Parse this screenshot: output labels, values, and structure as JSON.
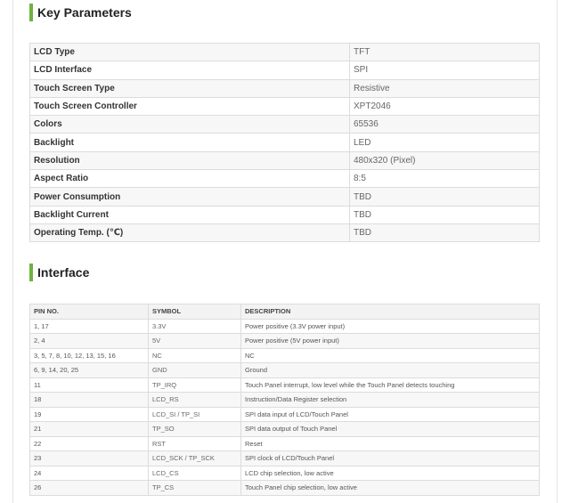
{
  "key_parameters": {
    "title": "Key Parameters",
    "rows": [
      {
        "key": "LCD Type",
        "value": "TFT"
      },
      {
        "key": "LCD Interface",
        "value": "SPI"
      },
      {
        "key": "Touch Screen Type",
        "value": "Resistive"
      },
      {
        "key": "Touch Screen Controller",
        "value": "XPT2046"
      },
      {
        "key": "Colors",
        "value": "65536"
      },
      {
        "key": "Backlight",
        "value": "LED"
      },
      {
        "key": "Resolution",
        "value": "480x320 (Pixel)"
      },
      {
        "key": "Aspect Ratio",
        "value": "8:5"
      },
      {
        "key": "Power Consumption",
        "value": "TBD"
      },
      {
        "key": "Backlight Current",
        "value": "TBD"
      },
      {
        "key": "Operating Temp. (℃)",
        "value": "TBD"
      }
    ]
  },
  "interface": {
    "title": "Interface",
    "headers": [
      "PIN NO.",
      "SYMBOL",
      "DESCRIPTION"
    ],
    "rows": [
      {
        "pin": "1, 17",
        "symbol": "3.3V",
        "desc": "Power positive (3.3V power input)"
      },
      {
        "pin": "2, 4",
        "symbol": "5V",
        "desc": "Power positive (5V power input)"
      },
      {
        "pin": "3, 5, 7, 8, 10, 12, 13, 15, 16",
        "symbol": "NC",
        "desc": "NC"
      },
      {
        "pin": "6, 9, 14, 20, 25",
        "symbol": "GND",
        "desc": "Ground"
      },
      {
        "pin": "11",
        "symbol": "TP_IRQ",
        "desc": "Touch Panel interrupt, low level while the Touch Panel detects touching"
      },
      {
        "pin": "18",
        "symbol": "LCD_RS",
        "desc": "Instruction/Data Register selection"
      },
      {
        "pin": "19",
        "symbol": "LCD_SI / TP_SI",
        "desc": "SPI data input of LCD/Touch Panel"
      },
      {
        "pin": "21",
        "symbol": "TP_SO",
        "desc": "SPI data output of Touch Panel"
      },
      {
        "pin": "22",
        "symbol": "RST",
        "desc": "Reset"
      },
      {
        "pin": "23",
        "symbol": "LCD_SCK / TP_SCK",
        "desc": "SPI clock of LCD/Touch Panel"
      },
      {
        "pin": "24",
        "symbol": "LCD_CS",
        "desc": "LCD chip selection, low active"
      },
      {
        "pin": "26",
        "symbol": "TP_CS",
        "desc": "Touch Panel chip selection, low active"
      }
    ]
  },
  "colors": {
    "accent": "#6cb33f"
  }
}
